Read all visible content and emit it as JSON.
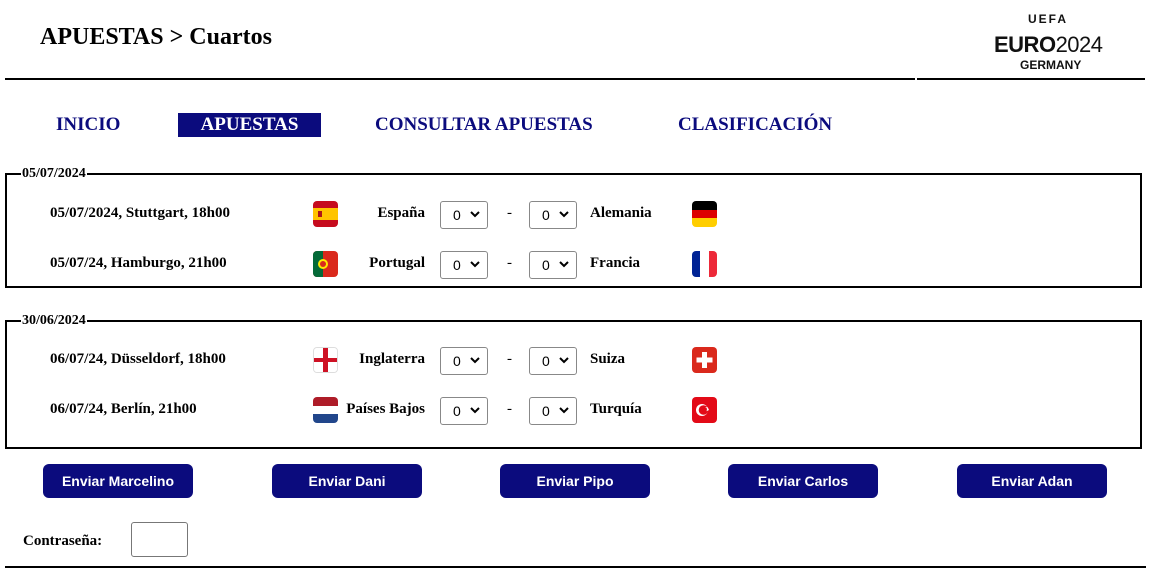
{
  "header": {
    "title": "APUESTAS > Cuartos",
    "logo": {
      "top": "UEFA",
      "euro": "EURO",
      "year": "2024",
      "country": "GERMANY"
    }
  },
  "nav": [
    {
      "label": "INICIO",
      "active": false
    },
    {
      "label": "APUESTAS",
      "active": true
    },
    {
      "label": "CONSULTAR APUESTAS",
      "active": false
    },
    {
      "label": "CLASIFICACIÓN",
      "active": false
    }
  ],
  "groups": [
    {
      "date": "05/07/2024",
      "matches": [
        {
          "info": "05/07/2024, Stuttgart, 18h00",
          "home": "España",
          "away": "Alemania",
          "home_score": "0",
          "away_score": "0",
          "home_flag": "spain-flag-icon",
          "away_flag": "germany-flag-icon"
        },
        {
          "info": "05/07/24, Hamburgo, 21h00",
          "home": "Portugal",
          "away": "Francia",
          "home_score": "0",
          "away_score": "0",
          "home_flag": "portugal-flag-icon",
          "away_flag": "france-flag-icon"
        }
      ]
    },
    {
      "date": "30/06/2024",
      "matches": [
        {
          "info": "06/07/24, Düsseldorf, 18h00",
          "home": "Inglaterra",
          "away": "Suiza",
          "home_score": "0",
          "away_score": "0",
          "home_flag": "england-flag-icon",
          "away_flag": "switzerland-flag-icon"
        },
        {
          "info": "06/07/24, Berlín, 21h00",
          "home": "Países Bajos",
          "away": "Turquía",
          "home_score": "0",
          "away_score": "0",
          "home_flag": "netherlands-flag-icon",
          "away_flag": "turkey-flag-icon"
        }
      ]
    }
  ],
  "separator": "-",
  "buttons": [
    "Enviar Marcelino",
    "Enviar Dani",
    "Enviar Pipo",
    "Enviar Carlos",
    "Enviar Adan"
  ],
  "password": {
    "label": "Contraseña:",
    "value": ""
  },
  "colors": {
    "accent": "#0b0b7d",
    "text": "#000000"
  }
}
